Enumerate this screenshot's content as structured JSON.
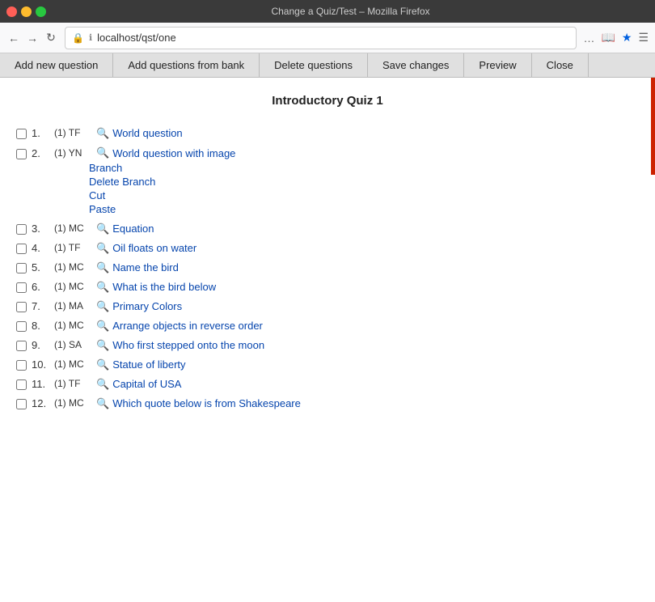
{
  "titlebar": {
    "title": "Change a Quiz/Test – Mozilla Firefox",
    "close_label": "×",
    "min_label": "−",
    "max_label": "□"
  },
  "urlbar": {
    "url": "localhost/qst/one",
    "shield_icon": "🛡",
    "info_icon": "ℹ"
  },
  "toolbar": {
    "buttons": [
      "Add new question",
      "Add questions from bank",
      "Delete questions",
      "Save changes",
      "Preview",
      "Close"
    ]
  },
  "page": {
    "title": "Introductory Quiz 1"
  },
  "questions": [
    {
      "num": "1.",
      "type": "(1) TF",
      "text": "World question",
      "has_context": false
    },
    {
      "num": "2.",
      "type": "(1) YN",
      "text": "World question with image",
      "has_context": true,
      "context_items": [
        "Branch",
        "Delete Branch",
        "Cut",
        "Paste"
      ]
    },
    {
      "num": "3.",
      "type": "(1) MC",
      "text": "Equation",
      "has_context": false
    },
    {
      "num": "4.",
      "type": "(1) TF",
      "text": "Oil floats on water",
      "has_context": false
    },
    {
      "num": "5.",
      "type": "(1) MC",
      "text": "Name the bird",
      "has_context": false
    },
    {
      "num": "6.",
      "type": "(1) MC",
      "text": "What is the bird below",
      "has_context": false
    },
    {
      "num": "7.",
      "type": "(1) MA",
      "text": "Primary Colors",
      "has_context": false
    },
    {
      "num": "8.",
      "type": "(1) MC",
      "text": "Arrange objects in reverse order",
      "has_context": false
    },
    {
      "num": "9.",
      "type": "(1) SA",
      "text": "Who first stepped onto the moon",
      "has_context": false
    },
    {
      "num": "10.",
      "type": "(1) MC",
      "text": "Statue of liberty",
      "has_context": false
    },
    {
      "num": "11.",
      "type": "(1) TF",
      "text": "Capital of USA",
      "has_context": false
    },
    {
      "num": "12.",
      "type": "(1) MC",
      "text": "Which quote below is from Shakespeare",
      "has_context": false
    }
  ],
  "icons": {
    "search": "🔍",
    "ellipsis": "…",
    "bookmark": "★",
    "shield": "🔒"
  },
  "colors": {
    "accent_red": "#cc2200",
    "link_blue": "#0645ad",
    "toolbar_bg": "#e0e0e0",
    "titlebar_bg": "#3a3a3a"
  }
}
